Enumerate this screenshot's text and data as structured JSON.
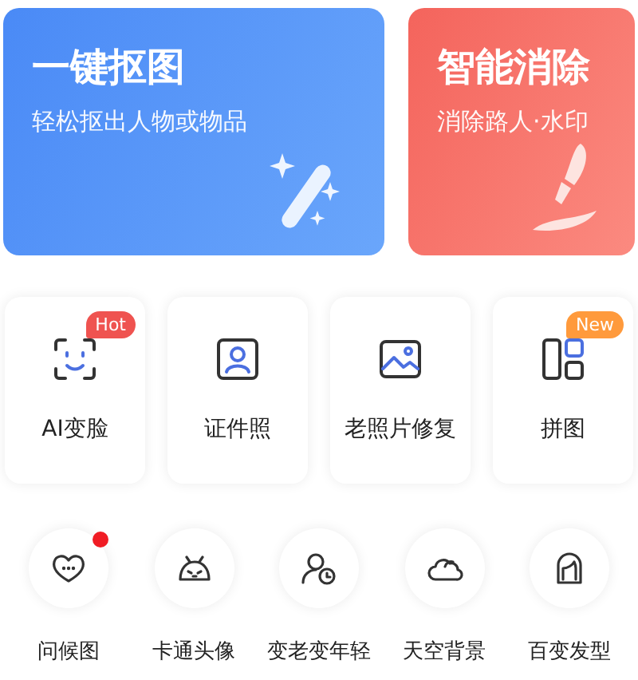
{
  "banners": [
    {
      "kind": "cutout",
      "title": "一键抠图",
      "subtitle": "轻松抠出人物或物品"
    },
    {
      "kind": "erase",
      "title": "智能消除",
      "subtitle": "消除路人·水印"
    }
  ],
  "tools": [
    {
      "kind": "face",
      "label": "AI变脸",
      "badge": {
        "text": "Hot",
        "color": "#ef5350"
      }
    },
    {
      "kind": "idphoto",
      "label": "证件照"
    },
    {
      "kind": "photo",
      "label": "老照片修复"
    },
    {
      "kind": "collage",
      "label": "拼图",
      "badge": {
        "text": "New",
        "color": "#ff9a3c"
      }
    }
  ],
  "features": [
    {
      "kind": "heart",
      "label": "问候图",
      "dot": true
    },
    {
      "kind": "cartoon",
      "label": "卡通头像",
      "dot": false
    },
    {
      "kind": "age",
      "label": "变老变年轻",
      "dot": false
    },
    {
      "kind": "cloud",
      "label": "天空背景",
      "dot": false
    },
    {
      "kind": "hair",
      "label": "百变发型",
      "dot": false
    }
  ]
}
